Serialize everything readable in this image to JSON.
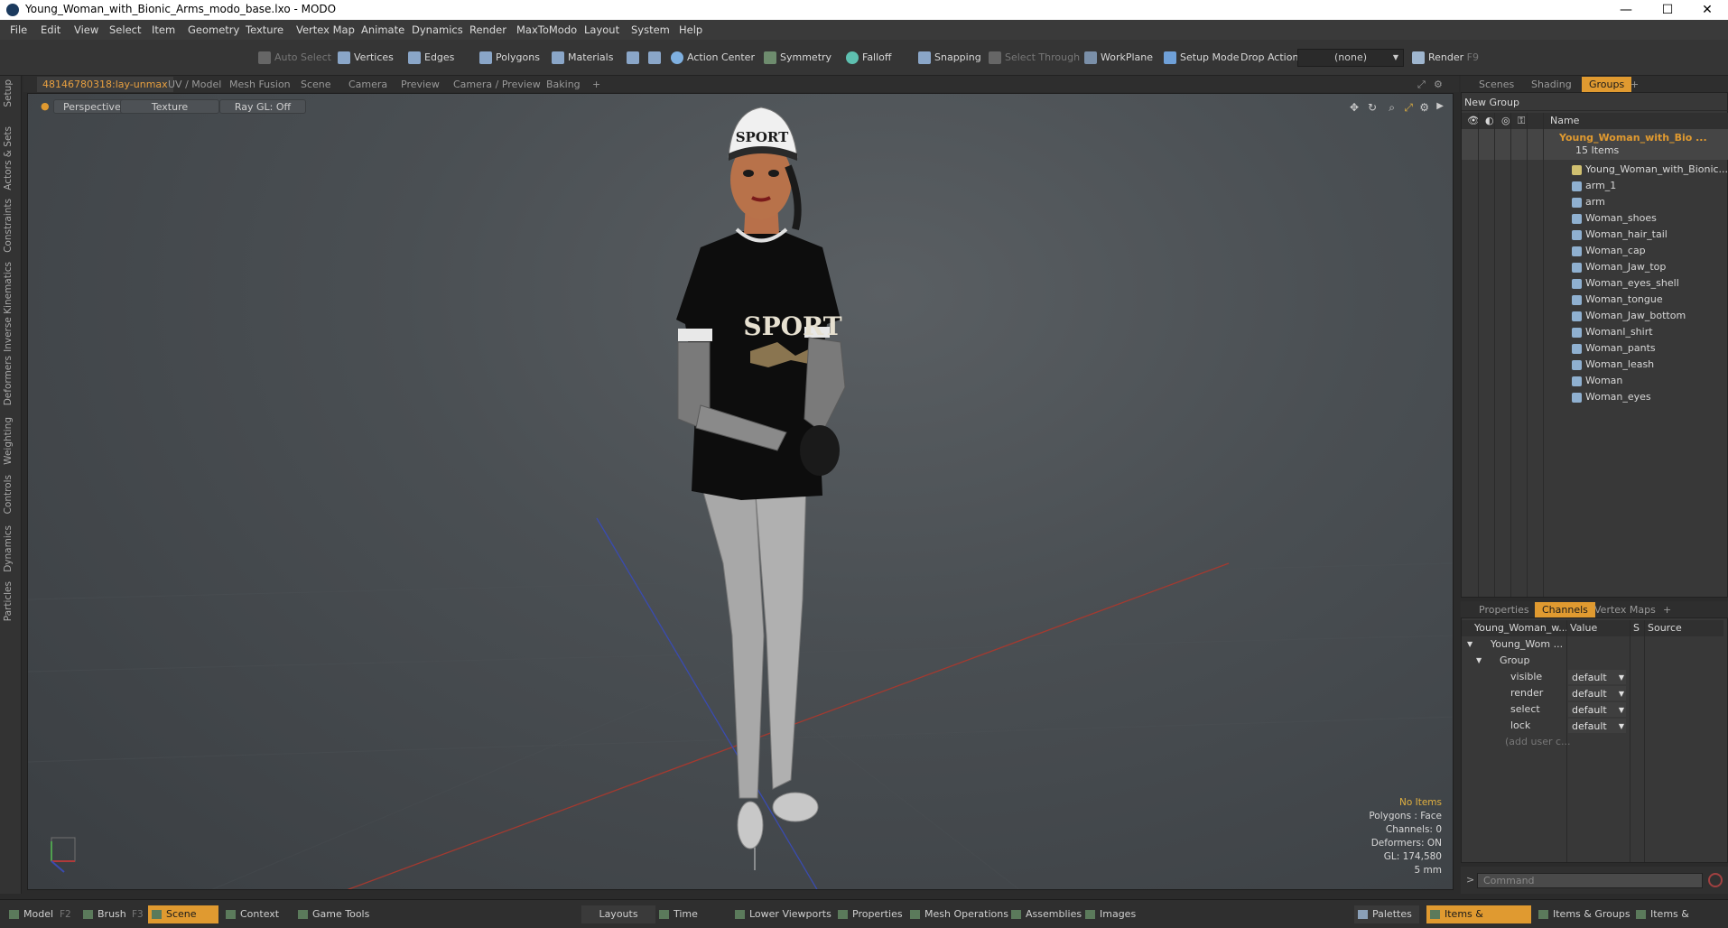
{
  "window": {
    "title": "Young_Woman_with_Bionic_Arms_modo_base.lxo - MODO",
    "minimize": "—",
    "maximize": "☐",
    "close": "✕"
  },
  "menu": [
    "File",
    "Edit",
    "View",
    "Select",
    "Item",
    "Geometry",
    "Texture",
    "Vertex Map",
    "Animate",
    "Dynamics",
    "Render",
    "MaxToModo",
    "Layout",
    "System",
    "Help"
  ],
  "toolbar": {
    "auto_select": "Auto Select",
    "vertices": "Vertices",
    "edges": "Edges",
    "polygons": "Polygons",
    "materials": "Materials",
    "action_center": "Action Center",
    "symmetry": "Symmetry",
    "falloff": "Falloff",
    "snapping": "Snapping",
    "select_through": "Select Through",
    "workplane": "WorkPlane",
    "setup_mode": "Setup Mode",
    "drop_action": "Drop Action",
    "drop_value": "(none)",
    "render": "Render",
    "render_key": "F9"
  },
  "left_tabs": [
    "Setup",
    "Actors & Sets",
    "Constraints",
    "Inverse Kinematics",
    "Deformers",
    "Weighting",
    "Controls",
    "Dynamics",
    "Particles"
  ],
  "viewport_tabs": [
    "48146780318:lay-unmax",
    "UV / Model",
    "Mesh Fusion",
    "Scene",
    "Camera",
    "Preview",
    "Camera / Preview",
    "Baking",
    "+"
  ],
  "viewport": {
    "perspective": "Perspective",
    "texture": "Texture",
    "raygl": "Ray GL: Off",
    "info": {
      "items": "No Items",
      "polygons": "Polygons : Face",
      "channels": "Channels: 0",
      "deformers": "Deformers: ON",
      "gl": "GL: 174,580",
      "scale": "5 mm"
    },
    "shirt_text": "SPORT",
    "cap_text": "SPORT"
  },
  "right_tabs": [
    "Scenes",
    "Shading",
    "Groups",
    "+"
  ],
  "groups": {
    "new_group": "New Group",
    "name_header": "Name",
    "group_name": "Young_Woman_with_Bio ...",
    "item_count": "15 Items",
    "items": [
      "Young_Woman_with_Bionic...",
      "arm_1",
      "arm",
      "Woman_shoes",
      "Woman_hair_tail",
      "Woman_cap",
      "Woman_Jaw_top",
      "Woman_eyes_shell",
      "Woman_tongue",
      "Woman_Jaw_bottom",
      "Womanl_shirt",
      "Woman_pants",
      "Woman_leash",
      "Woman",
      "Woman_eyes"
    ]
  },
  "channel_tabs": [
    "Properties",
    "Channels",
    "Vertex Maps",
    "+"
  ],
  "channels": {
    "col_name": "Young_Woman_w...",
    "col_value": "Value",
    "col_s": "S",
    "col_source": "Source",
    "root": "Young_Wom ...",
    "group": "Group",
    "rows": [
      {
        "name": "visible",
        "value": "default"
      },
      {
        "name": "render",
        "value": "default"
      },
      {
        "name": "select",
        "value": "default"
      },
      {
        "name": "lock",
        "value": "default"
      }
    ],
    "add_user": "(add user c..."
  },
  "command": {
    "prompt": ">",
    "placeholder": "Command"
  },
  "bottom": {
    "model": "Model",
    "model_key": "F2",
    "brush": "Brush",
    "brush_key": "F3",
    "scene": "Scene",
    "scene_key": "F4",
    "context": "Context",
    "game_tools": "Game Tools",
    "layouts": "Layouts",
    "time": "Time",
    "lower_viewports": "Lower Viewports",
    "properties": "Properties",
    "mesh_operations": "Mesh Operations",
    "assemblies": "Assemblies",
    "images": "Images",
    "palettes": "Palettes",
    "items_properties": "Items & Properties",
    "items_groups": "Items & Groups",
    "items_shading": "Items & Shading"
  }
}
